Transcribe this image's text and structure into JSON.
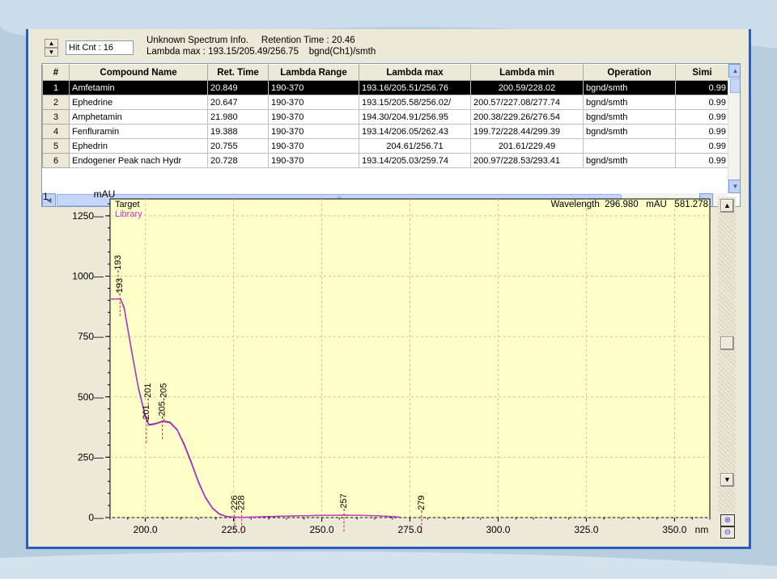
{
  "header": {
    "hit_count": "Hit Cnt : 16",
    "info_line1": "Unknown Spectrum Info.     Retention Time : 20.46",
    "info_line2": "Lambda max : 193.15/205.49/256.75    bgnd(Ch1)/smth"
  },
  "table": {
    "columns": [
      "#",
      "Compound Name",
      "Ret. Time",
      "Lambda Range",
      "Lambda max",
      "Lambda min",
      "Operation",
      "Simi"
    ],
    "rows": [
      [
        "1",
        "Amfetamin",
        "20.849",
        "190-370",
        "193.16/205.51/256.76",
        "200.59/228.02",
        "bgnd/smth",
        "0.99"
      ],
      [
        "2",
        "Ephedrine",
        "20.647",
        "190-370",
        "193.15/205.58/256.02/",
        "200.57/227.08/277.74",
        "bgnd/smth",
        "0.99"
      ],
      [
        "3",
        "Amphetamin",
        "21.980",
        "190-370",
        "194.30/204.91/256.95",
        "200.38/229.26/276.54",
        "bgnd/smth",
        "0.99"
      ],
      [
        "4",
        "Fenfluramin",
        "19.388",
        "190-370",
        "193.14/206.05/262.43",
        "199.72/228.44/299.39",
        "bgnd/smth",
        "0.99"
      ],
      [
        "5",
        "Ephedrin",
        "20.755",
        "190-370",
        "204.61/256.71",
        "201.61/229.49",
        "",
        "0.99"
      ],
      [
        "6",
        "Endogener Peak nach Hydr",
        "20.728",
        "190-370",
        "193.14/205.03/259.74",
        "200.97/228.53/293.41",
        "bgnd/smth",
        "0.99"
      ]
    ],
    "selected_row": 0
  },
  "panel_number": "1",
  "chart_data": {
    "type": "line",
    "y_unit": "mAU",
    "x_unit": "nm",
    "legend": [
      "Target",
      "Library"
    ],
    "readout": "Wavelength  296.980   mAU   581.278",
    "xlim": [
      190,
      360
    ],
    "ylim": [
      0,
      1320
    ],
    "x_ticks": [
      "200.0",
      "225.0",
      "250.0",
      "275.0",
      "300.0",
      "325.0",
      "350.0"
    ],
    "y_ticks": [
      "0",
      "250",
      "500",
      "750",
      "1000",
      "1250"
    ],
    "series": [
      {
        "name": "Target",
        "color": "#2a1a8a",
        "x": [
          190,
          193,
          194,
          196,
          198,
          200,
          201,
          203,
          205,
          207,
          209,
          211,
          213,
          215,
          217,
          219,
          221,
          223,
          225,
          228,
          232,
          240,
          250,
          257,
          265,
          270,
          272
        ],
        "y": [
          905,
          905,
          870,
          700,
          540,
          420,
          385,
          390,
          400,
          395,
          365,
          305,
          230,
          150,
          85,
          40,
          15,
          5,
          2,
          1,
          3,
          6,
          9,
          10,
          8,
          4,
          2
        ]
      },
      {
        "name": "Library",
        "color": "#cc33cc",
        "x": [
          190,
          193,
          194,
          196,
          198,
          200,
          201,
          203,
          205,
          207,
          209,
          211,
          213,
          215,
          217,
          219,
          221,
          223,
          225,
          228,
          232,
          240,
          250,
          257,
          265,
          270,
          272
        ],
        "y": [
          905,
          905,
          865,
          695,
          535,
          415,
          382,
          388,
          398,
          392,
          362,
          300,
          225,
          146,
          82,
          38,
          13,
          4,
          2,
          1,
          3,
          6,
          9,
          10,
          8,
          4,
          2
        ]
      }
    ],
    "peak_labels": [
      {
        "x": 193,
        "y": 1000,
        "text": "193"
      },
      {
        "x": 193.5,
        "y": 905,
        "text": "193"
      },
      {
        "x": 201,
        "y": 380,
        "text": "201"
      },
      {
        "x": 201.5,
        "y": 470,
        "text": "201"
      },
      {
        "x": 205.5,
        "y": 395,
        "text": "205"
      },
      {
        "x": 206,
        "y": 470,
        "text": "205"
      },
      {
        "x": 226,
        "y": 5,
        "text": "226"
      },
      {
        "x": 228,
        "y": 5,
        "text": "228"
      },
      {
        "x": 257,
        "y": 12,
        "text": "257"
      },
      {
        "x": 279,
        "y": 5,
        "text": "279"
      }
    ]
  }
}
